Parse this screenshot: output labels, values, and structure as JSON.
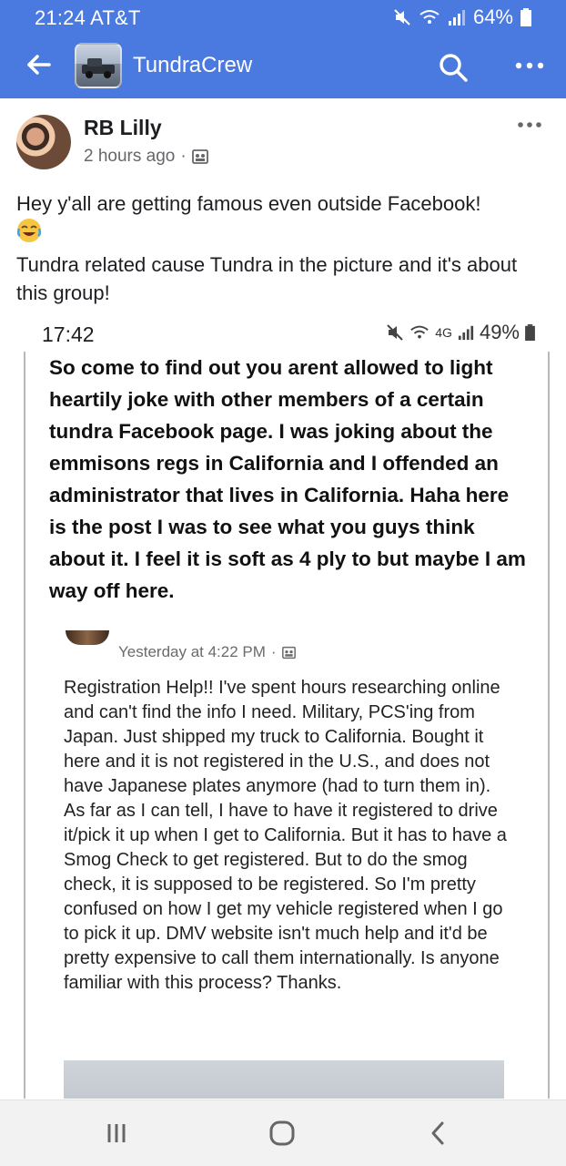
{
  "status_bar": {
    "time": "21:24 AT&T",
    "battery": "64%",
    "icons": [
      "mute-icon",
      "wifi-icon",
      "signal-icon",
      "battery-icon"
    ]
  },
  "app_bar": {
    "title": "TundraCrew",
    "back_icon": "arrow-left-icon",
    "search_icon": "search-icon",
    "more_icon": "more-horizontal-icon",
    "background": "#4a7ae0"
  },
  "post": {
    "author": "RB Lilly",
    "timestamp": "2 hours ago",
    "privacy_icon": "group-icon",
    "text_line1": "Hey y'all are getting famous even outside Facebook!",
    "emoji": "joy-emoji",
    "text_line2": "Tundra related cause Tundra in the picture and it's about this group!"
  },
  "embedded_screenshot": {
    "time": "17:42",
    "network": "4G",
    "battery": "49%",
    "body": "So come to find out you arent allowed to light heartily joke with other members of a certain tundra Facebook page. I was joking about the emmisons regs in California and I offended an administrator that lives in California. Haha here is the post I was to see what you guys think about it. I feel it is soft as 4 ply to but maybe I am way off here.",
    "inner_post": {
      "timestamp": "Yesterday at 4:22 PM",
      "paragraph1": "Registration Help!! I've spent hours researching online and can't find the info I need. Military, PCS'ing from Japan. Just shipped my truck to California. Bought it here and it is not registered in the U.S., and does not have Japanese plates anymore (had to turn them in).",
      "paragraph2": "As far as I can tell, I have to have it registered to drive it/pick it up when I get to California. But it has to have a Smog Check to get registered. But to do the smog check, it is supposed to be registered. So I'm pretty confused on how I get my vehicle registered when I go to pick it up. DMV website isn't much help and it'd be pretty expensive to call them internationally. Is anyone familiar with this process? Thanks."
    }
  },
  "nav_bar": {
    "recent_icon": "recent-apps-icon",
    "home_icon": "home-icon",
    "back_icon": "back-chevron-icon"
  }
}
